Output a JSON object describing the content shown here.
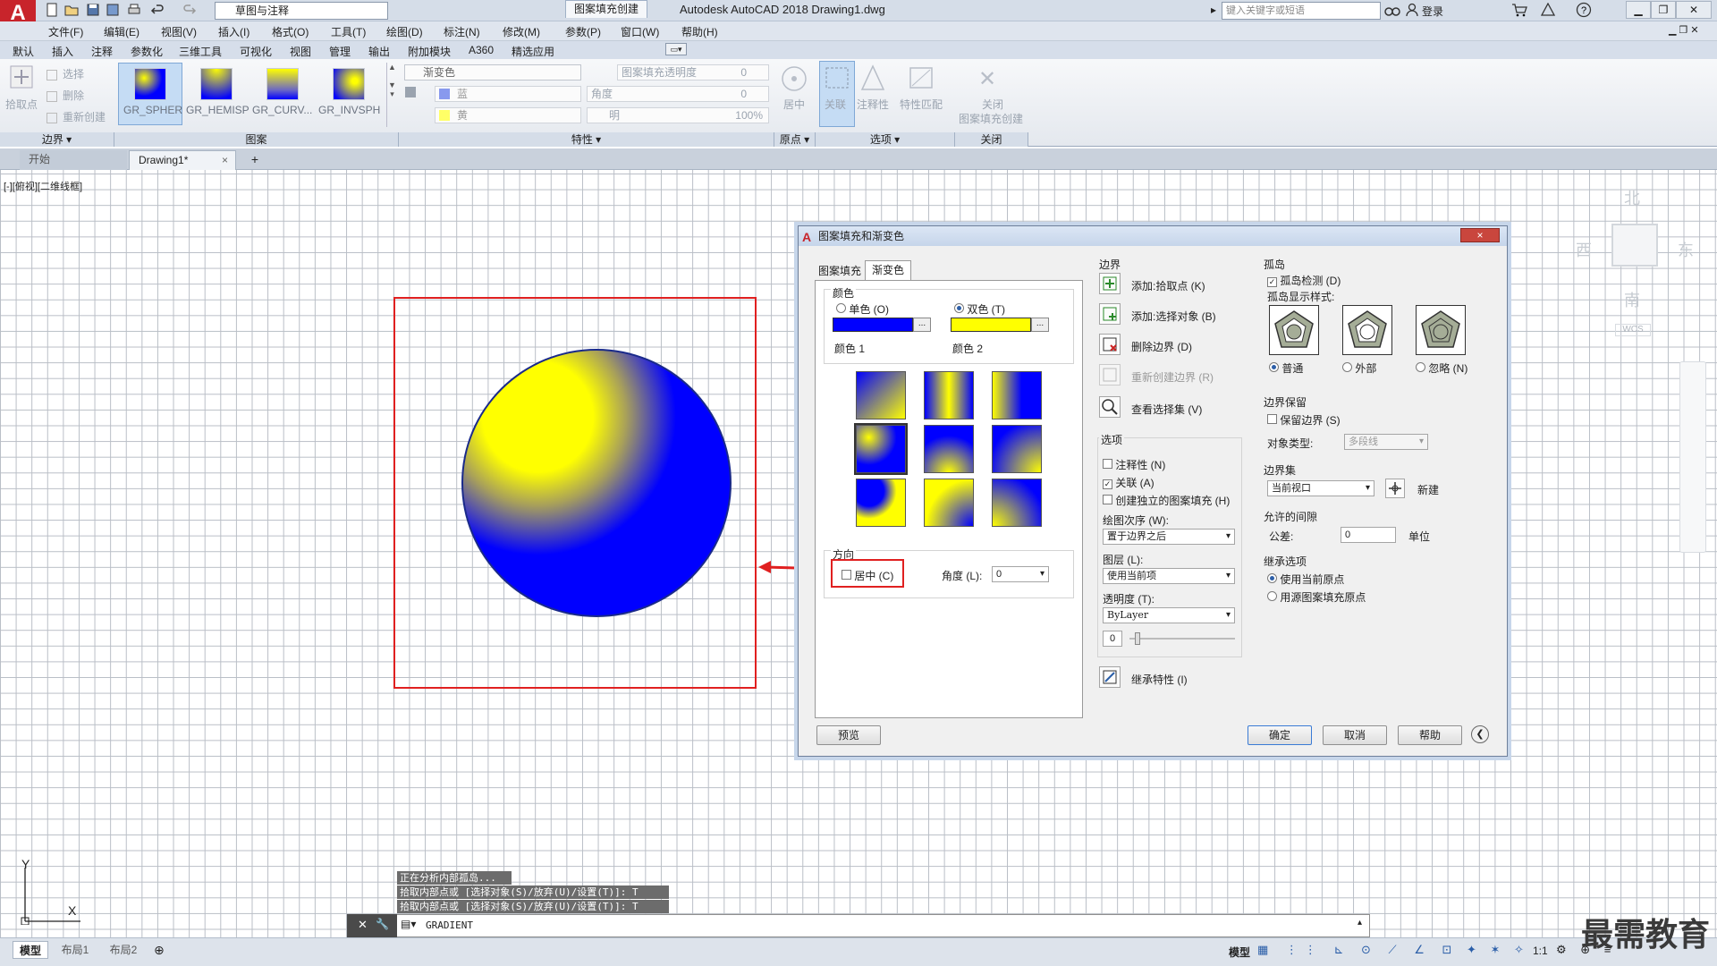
{
  "titlebar": {
    "app_logo": "A",
    "workspace": "草图与注释",
    "title": "Autodesk AutoCAD 2018    Drawing1.dwg",
    "search_placeholder": "键入关键字或短语",
    "login": "登录"
  },
  "menu": [
    "文件(F)",
    "编辑(E)",
    "视图(V)",
    "插入(I)",
    "格式(O)",
    "工具(T)",
    "绘图(D)",
    "标注(N)",
    "修改(M)",
    "参数(P)",
    "窗口(W)",
    "帮助(H)"
  ],
  "ribbon_tabs": [
    "默认",
    "插入",
    "注释",
    "参数化",
    "三维工具",
    "可视化",
    "视图",
    "管理",
    "输出",
    "附加模块",
    "A360",
    "精选应用"
  ],
  "ribbon_active_tab": "图案填充创建",
  "ribbon": {
    "boundary": {
      "pick": "拾取点",
      "select": "选择",
      "remove": "删除",
      "recreate": "重新创建",
      "label": "边界"
    },
    "pattern": {
      "items": [
        "GR_SPHER",
        "GR_HEMISP",
        "GR_CURV...",
        "GR_INVSPH"
      ],
      "label": "图案"
    },
    "props": {
      "type": "渐变色",
      "color1": "蓝",
      "color2": "黄",
      "transparency": "图案填充透明度",
      "transparency_val": "0",
      "angle": "角度",
      "angle_val": "0",
      "tint": "明",
      "tint_val": "100%",
      "label": "特性"
    },
    "origin": {
      "center": "居中",
      "label": "原点"
    },
    "options": {
      "associative": "关联",
      "annotative": "注释性",
      "match": "特性匹配",
      "label": "选项"
    },
    "close": {
      "text1": "关闭",
      "text2": "图案填充创建",
      "label": "关闭"
    }
  },
  "doc_tabs": {
    "start": "开始",
    "drawing": "Drawing1*",
    "close": "×",
    "add": "+"
  },
  "viewport_label": "[-][俯视][二维线框]",
  "viewcube": {
    "north": "北",
    "south": "南",
    "east": "东",
    "west": "西",
    "wcs": "WCS"
  },
  "ucs": {
    "x": "X",
    "y": "Y"
  },
  "dialog": {
    "title": "图案填充和渐变色",
    "close": "×",
    "tabs": [
      "图案填充",
      "渐变色"
    ],
    "color_group": "颜色",
    "single_color": "单色 (O)",
    "two_color": "双色 (T)",
    "color1_label": "颜色 1",
    "color2_label": "颜色 2",
    "color1": "#0000ff",
    "color2": "#ffff00",
    "orientation_group": "方向",
    "centered": "居中 (C)",
    "angle_label": "角度 (L):",
    "angle_value": "0",
    "preview": "预览",
    "boundaries": "边界",
    "add_pick": "添加:拾取点 (K)",
    "add_select": "添加:选择对象 (B)",
    "remove_boundary": "删除边界 (D)",
    "recreate_boundary": "重新创建边界 (R)",
    "view_selection": "查看选择集 (V)",
    "options": "选项",
    "annotative": "注释性 (N)",
    "associative": "关联 (A)",
    "separate": "创建独立的图案填充 (H)",
    "draw_order_label": "绘图次序 (W):",
    "draw_order": "置于边界之后",
    "layer_label": "图层 (L):",
    "layer": "使用当前项",
    "transparency_label": "透明度 (T):",
    "transparency": "ByLayer",
    "transparency_value": "0",
    "inherit": "继承特性 (I)",
    "islands": "孤岛",
    "island_detect": "孤岛检测 (D)",
    "island_style": "孤岛显示样式:",
    "style_normal": "普通",
    "style_outer": "外部",
    "style_ignore": "忽略 (N)",
    "retain": "边界保留",
    "retain_boundaries": "保留边界 (S)",
    "object_type_label": "对象类型:",
    "object_type": "多段线",
    "boundary_set": "边界集",
    "boundary_set_value": "当前视口",
    "new": "新建",
    "gap": "允许的间隙",
    "tolerance_label": "公差:",
    "tolerance_value": "0",
    "units": "单位",
    "inherit_options": "继承选项",
    "use_current_origin": "使用当前原点",
    "use_source_origin": "用源图案填充原点",
    "ok": "确定",
    "cancel": "取消",
    "help": "帮助"
  },
  "command": {
    "history": [
      "正在分析内部孤岛...",
      "拾取内部点或 [选择对象(S)/放弃(U)/设置(T)]: T",
      "拾取内部点或 [选择对象(S)/放弃(U)/设置(T)]: T"
    ],
    "current": "GRADIENT"
  },
  "layout_tabs": [
    "模型",
    "布局1",
    "布局2"
  ],
  "status": {
    "model": "模型",
    "scale": "1:1"
  },
  "watermark": "最需教育"
}
